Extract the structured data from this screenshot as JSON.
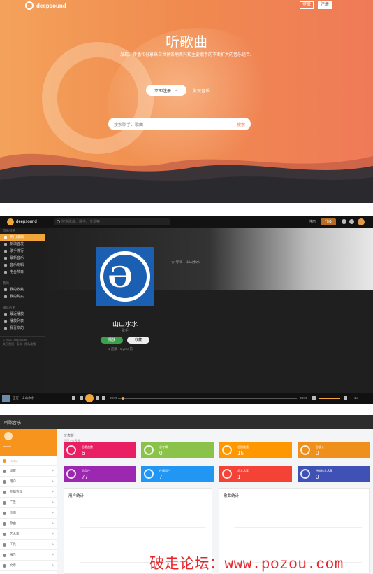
{
  "hero": {
    "brand": "deepsound",
    "login_label": "登录",
    "register_label": "注册",
    "title": "听歌曲",
    "subtitle": "发现、传播和分享来自世界各地新兴和主要歌手的不断扩大的音乐组合。",
    "start_label": "立即注册",
    "discover_label": "发现音乐",
    "search_placeholder": "搜索歌手、歌曲",
    "search_button": "搜索",
    "colors": {
      "accent": "#ef7a58",
      "wave_dark": "#2a2a2e"
    }
  },
  "app": {
    "brand": "deepsound",
    "search_placeholder": "搜索歌曲、歌手、专辑等",
    "login_label": "注册",
    "vip_label": "升级",
    "sidebar": {
      "section_1": "音乐频道",
      "items_1": [
        "热门歌曲",
        "新歌首发",
        "歌手排行",
        "最新音乐",
        "音乐专辑",
        "电台节目"
      ],
      "section_2": "我的",
      "items_2": [
        "我的收藏",
        "我的购买"
      ],
      "section_3": "播放历史",
      "items_3": [
        "最近播放",
        "播放列表",
        "我喜欢的"
      ],
      "footer_1": "© 2021 DeepSound",
      "footer_2": "关于我们 · 条款 · 隐私政策"
    },
    "breadcrumb": "专辑 › 山山水水",
    "album": {
      "name": "山山水水",
      "sub": "歌手",
      "play_label": "播放",
      "fav_label": "收藏",
      "meta": "1 首歌 · 1 year 前"
    },
    "player": {
      "now_playing": "正在 · 山山水水",
      "time_start": "00:00",
      "time_end": "03:26",
      "rate": "1x",
      "progress": 0.02
    }
  },
  "admin": {
    "title": "听歌音乐",
    "user": "admin",
    "breadcrumb": "仪表板",
    "breadcrumb_sub": "首页 › 仪表板",
    "menu": [
      {
        "label": "Home",
        "active": true
      },
      {
        "label": "设置",
        "active": false
      },
      {
        "label": "用户",
        "active": false
      },
      {
        "label": "专辑管理",
        "active": false
      },
      {
        "label": "广告",
        "active": false
      },
      {
        "label": "页面",
        "active": false
      },
      {
        "label": "歌曲",
        "active": false
      },
      {
        "label": "艺术家",
        "active": false
      },
      {
        "label": "工具",
        "active": false
      },
      {
        "label": "报告",
        "active": false
      },
      {
        "label": "文章",
        "active": false
      }
    ],
    "cards": [
      {
        "label": "总歌曲数",
        "value": "6",
        "color": "#e91e63"
      },
      {
        "label": "总专辑",
        "value": "0",
        "color": "#8bc34a"
      },
      {
        "label": "总播放量",
        "value": "15",
        "color": "#ff9800"
      },
      {
        "label": "总收入",
        "value": "0",
        "color": "#ef8f1c"
      },
      {
        "label": "总用户",
        "value": "77",
        "color": "#9c27b0"
      },
      {
        "label": "在线用户",
        "value": "7",
        "color": "#2196f3"
      },
      {
        "label": "总艺术家",
        "value": "1",
        "color": "#f44336"
      },
      {
        "label": "待审核艺术家",
        "value": "0",
        "color": "#3f51b5"
      }
    ],
    "panel_left": "用户统计",
    "panel_right": "歌曲统计"
  },
  "watermark": {
    "prefix": "破走论坛：",
    "url": "www.pozou.com"
  }
}
